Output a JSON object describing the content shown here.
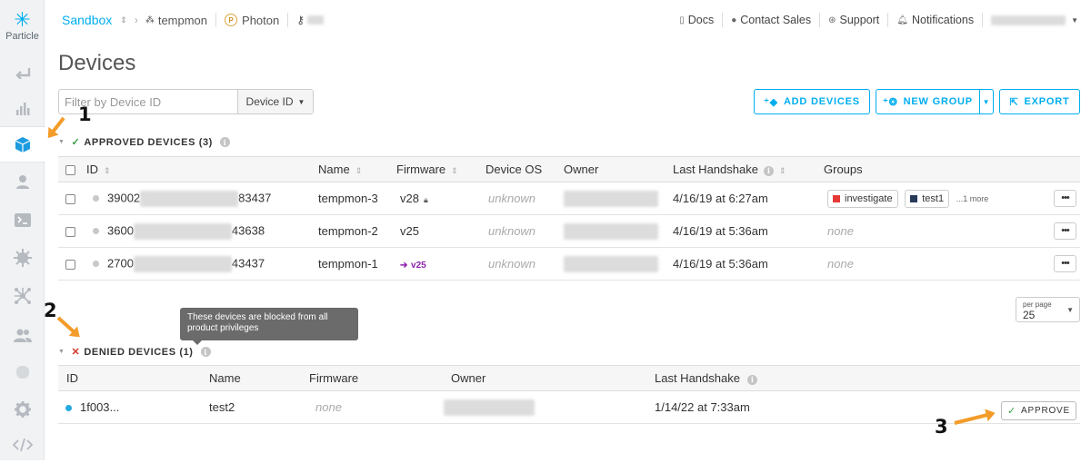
{
  "sidebar": {
    "logo_label": "Particle",
    "items": [
      {
        "icon": "back-icon"
      },
      {
        "icon": "bar-chart-icon"
      },
      {
        "icon": "cube-icon",
        "active": true
      },
      {
        "icon": "user-icon"
      },
      {
        "icon": "terminal-icon"
      },
      {
        "icon": "chip-icon"
      },
      {
        "icon": "network-icon"
      },
      {
        "icon": "team-icon"
      },
      {
        "icon": "database-icon"
      },
      {
        "icon": "gear-icon"
      },
      {
        "icon": "code-icon"
      }
    ]
  },
  "breadcrumb": {
    "sandbox": "Sandbox",
    "product": "tempmon",
    "platform": "Photon",
    "platform_badge": "P"
  },
  "top_links": {
    "docs": "Docs",
    "contact_sales": "Contact Sales",
    "support": "Support",
    "notifications": "Notifications"
  },
  "page_title": "Devices",
  "filter": {
    "placeholder": "Filter by Device ID",
    "dropdown": "Device ID"
  },
  "buttons": {
    "add_devices": "ADD DEVICES",
    "new_group": "NEW GROUP",
    "export": "EXPORT"
  },
  "approved": {
    "title": "APPROVED DEVICES (3)",
    "columns": {
      "id": "ID",
      "name": "Name",
      "firmware": "Firmware",
      "device_os": "Device OS",
      "owner": "Owner",
      "last_handshake": "Last Handshake",
      "groups": "Groups"
    },
    "rows": [
      {
        "id_prefix": "39002",
        "id_suffix": "83437",
        "name": "tempmon-3",
        "firmware": "v28",
        "device_os": "unknown",
        "last_handshake": "4/16/19 at 6:27am",
        "groups": [
          {
            "name": "investigate",
            "color": "#e53935"
          },
          {
            "name": "test1",
            "color": "#283a5a"
          }
        ],
        "more": "...1 more"
      },
      {
        "id_prefix": "3600",
        "id_suffix": "43638",
        "name": "tempmon-2",
        "firmware": "v25",
        "device_os": "unknown",
        "last_handshake": "4/16/19 at 5:36am",
        "groups_text": "none"
      },
      {
        "id_prefix": "2700",
        "id_suffix": "43437",
        "name": "tempmon-1",
        "firmware": "v25",
        "device_os": "unknown",
        "last_handshake": "4/16/19 at 5:36am",
        "groups_text": "none"
      }
    ],
    "menu_label": "•••"
  },
  "per_page": {
    "label": "per page",
    "value": "25"
  },
  "tooltip": "These devices are blocked from all product privileges",
  "denied": {
    "title": "DENIED DEVICES (1)",
    "columns": {
      "id": "ID",
      "name": "Name",
      "firmware": "Firmware",
      "owner": "Owner",
      "last_handshake": "Last Handshake"
    },
    "rows": [
      {
        "id": "1f003...",
        "name": "test2",
        "firmware": "none",
        "last_handshake": "1/14/22 at 7:33am",
        "approve": "APPROVE"
      }
    ]
  },
  "annotations": {
    "one": "1",
    "two": "2",
    "three": "3"
  },
  "colors": {
    "accent": "#00aeef",
    "annotation": "#f39c2a",
    "online": "#25a9e0"
  }
}
